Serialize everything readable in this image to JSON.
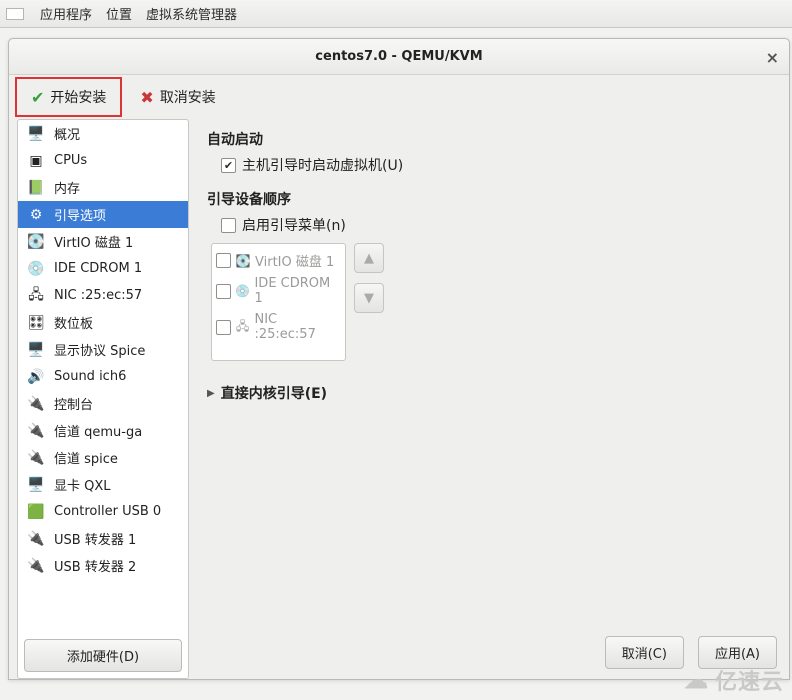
{
  "desktop_menu": {
    "apps": "应用程序",
    "places": "位置",
    "vmm": "虚拟系统管理器"
  },
  "window": {
    "title": "centos7.0 - QEMU/KVM"
  },
  "toolbar": {
    "begin_install": "开始安装",
    "cancel_install": "取消安装"
  },
  "sidebar": {
    "items": [
      {
        "icon": "🖥️",
        "label": "概况"
      },
      {
        "icon": "▣",
        "label": "CPUs"
      },
      {
        "icon": "📗",
        "label": "内存"
      },
      {
        "icon": "⚙",
        "label": "引导选项",
        "selected": true
      },
      {
        "icon": "💽",
        "label": "VirtIO 磁盘 1"
      },
      {
        "icon": "💿",
        "label": "IDE CDROM 1"
      },
      {
        "icon": "🖧",
        "label": "NIC :25:ec:57"
      },
      {
        "icon": "🎛",
        "label": "数位板"
      },
      {
        "icon": "🖥️",
        "label": "显示协议 Spice"
      },
      {
        "icon": "🔊",
        "label": "Sound ich6"
      },
      {
        "icon": "🔌",
        "label": "控制台"
      },
      {
        "icon": "🔌",
        "label": "信道 qemu-ga"
      },
      {
        "icon": "🔌",
        "label": "信道 spice"
      },
      {
        "icon": "🖥️",
        "label": "显卡 QXL"
      },
      {
        "icon": "🟩",
        "label": "Controller USB 0"
      },
      {
        "icon": "🔌",
        "label": "USB 转发器 1"
      },
      {
        "icon": "🔌",
        "label": "USB 转发器 2"
      }
    ],
    "add_hw": "添加硬件(D)"
  },
  "content": {
    "autostart_title": "自动启动",
    "autostart_checkbox": "主机引导时启动虚拟机(U)",
    "autostart_checked": true,
    "bootorder_title": "引导设备顺序",
    "boot_menu_checkbox": "启用引导菜单(n)",
    "boot_menu_checked": false,
    "boot_devices": [
      {
        "icon": "💽",
        "label": "VirtIO 磁盘 1"
      },
      {
        "icon": "💿",
        "label": "IDE CDROM 1"
      },
      {
        "icon": "🖧",
        "label": "NIC :25:ec:57"
      }
    ],
    "direct_kernel": "直接内核引导(E)"
  },
  "buttons": {
    "cancel": "取消(C)",
    "apply": "应用(A)"
  },
  "watermark": "亿速云"
}
